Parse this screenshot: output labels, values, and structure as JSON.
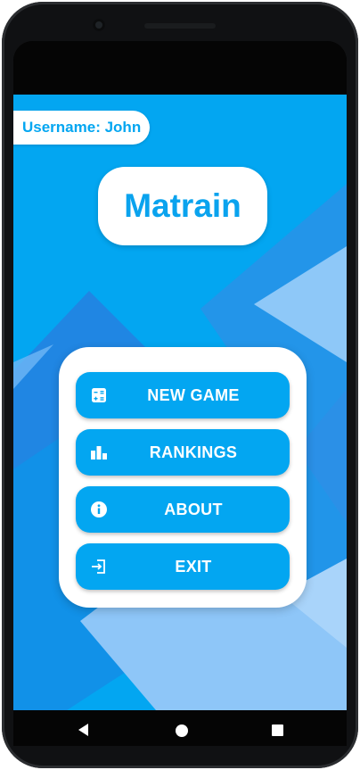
{
  "header": {
    "username_label": "Username: John"
  },
  "app": {
    "title": "Matrain"
  },
  "menu": {
    "items": [
      {
        "label": "NEW GAME",
        "icon": "calculator-icon"
      },
      {
        "label": "RANKINGS",
        "icon": "bar-chart-icon"
      },
      {
        "label": "ABOUT",
        "icon": "info-icon"
      },
      {
        "label": "EXIT",
        "icon": "exit-icon"
      }
    ]
  },
  "navigation": {
    "buttons": [
      "back",
      "home",
      "recents"
    ]
  },
  "colors": {
    "primary": "#03a6f1",
    "white": "#ffffff"
  }
}
